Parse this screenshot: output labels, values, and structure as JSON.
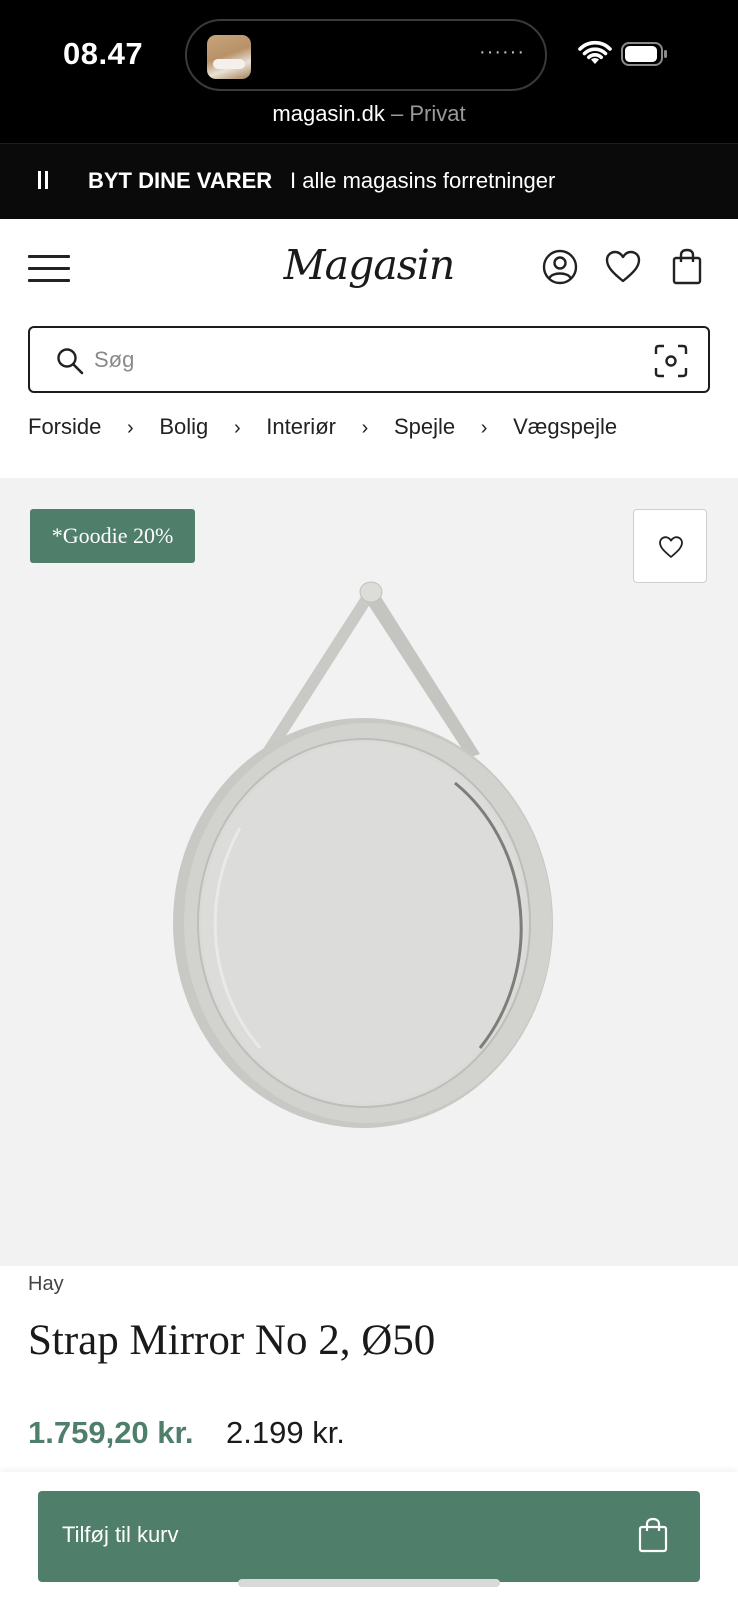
{
  "status_bar": {
    "time": "08.47",
    "url_domain": "magasin.dk",
    "url_mode": " – Privat",
    "dots": "······"
  },
  "promo": {
    "bold": "BYT DINE VARER",
    "text": "I alle magasins forretninger"
  },
  "header": {
    "logo": "Magasin",
    "icons": [
      "menu-icon",
      "account-icon",
      "heart-icon",
      "bag-icon"
    ]
  },
  "search": {
    "placeholder": "Søg",
    "value": ""
  },
  "breadcrumb": [
    "Forside",
    "Bolig",
    "Interiør",
    "Spejle",
    "Vægspejle"
  ],
  "product": {
    "badge": "*Goodie 20%",
    "brand": "Hay",
    "title": "Strap Mirror No 2, Ø50",
    "sale_price": "1.759,20 kr.",
    "original_price": "2.199 kr."
  },
  "cta": {
    "add_to_cart": "Tilføj til kurv"
  },
  "colors": {
    "accent": "#4f7e6b",
    "topbar": "#000000",
    "hero_bg": "#f2f2f2"
  }
}
